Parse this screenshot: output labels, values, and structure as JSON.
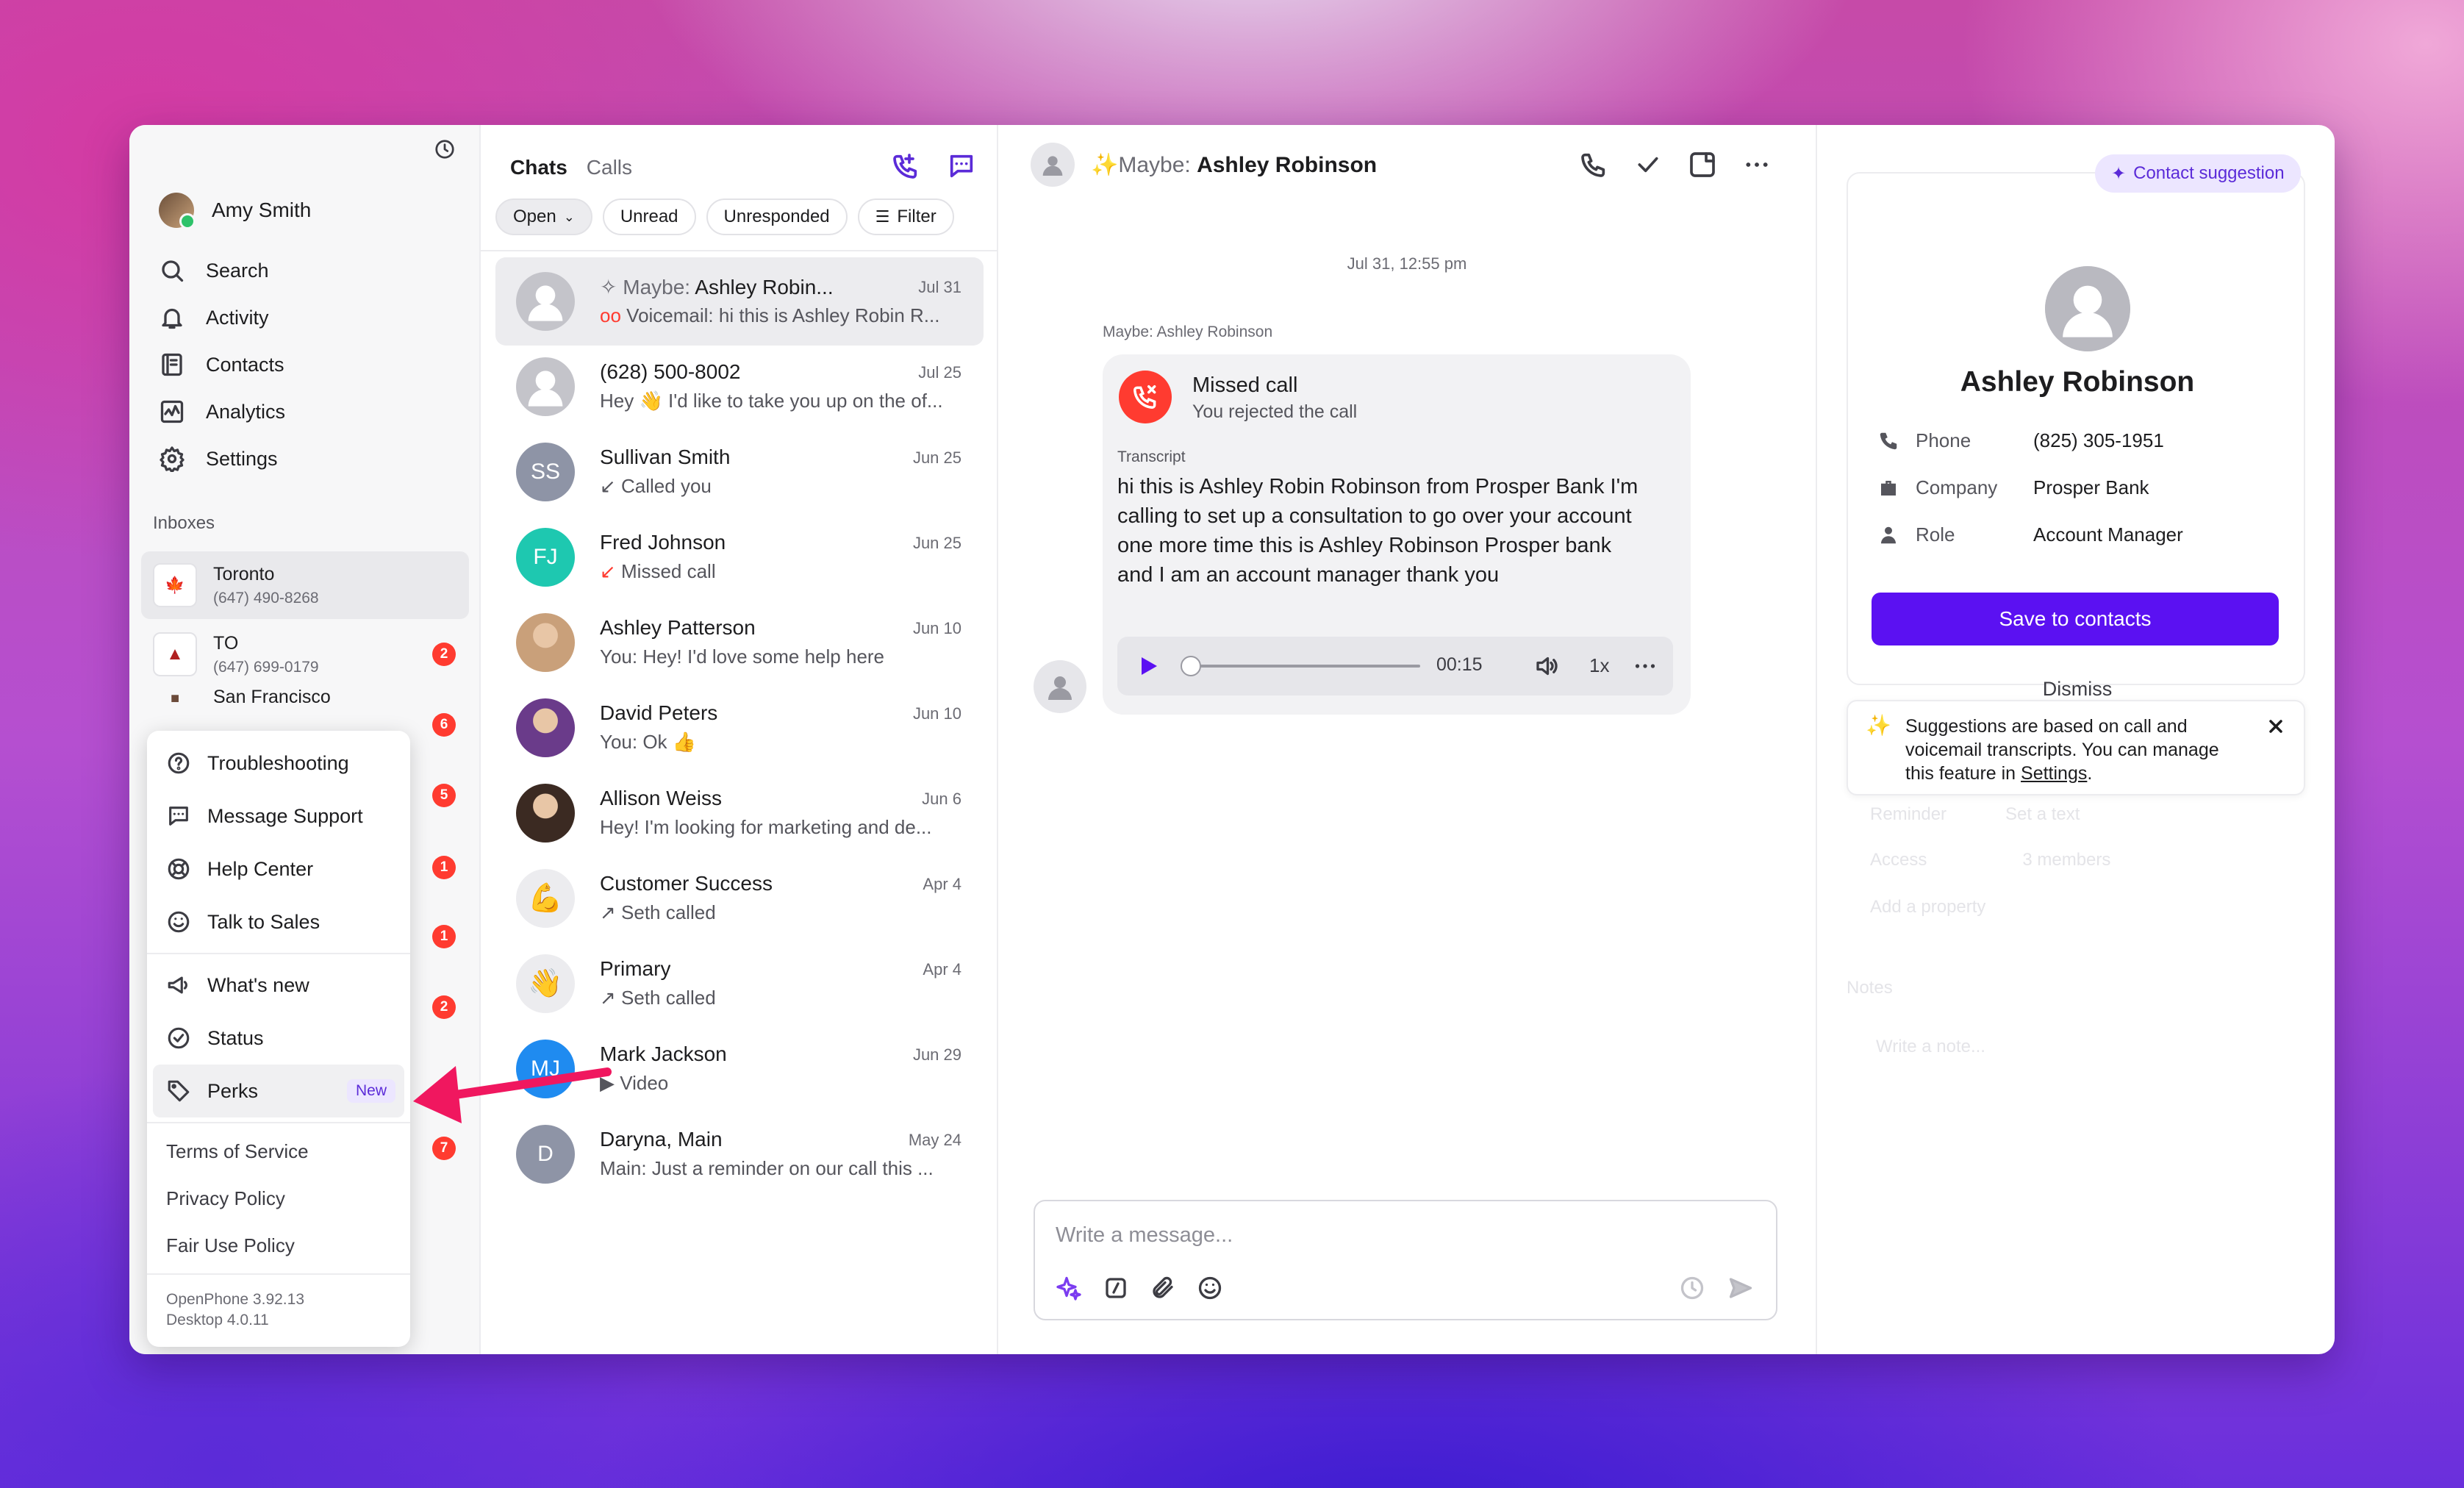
{
  "sidebar": {
    "user_name": "Amy Smith",
    "nav": [
      {
        "label": "Search",
        "icon": "search-icon"
      },
      {
        "label": "Activity",
        "icon": "bell-icon"
      },
      {
        "label": "Contacts",
        "icon": "contacts-icon"
      },
      {
        "label": "Analytics",
        "icon": "analytics-icon"
      },
      {
        "label": "Settings",
        "icon": "gear-icon"
      }
    ],
    "inboxes_label": "Inboxes",
    "inboxes": [
      {
        "name": "Toronto",
        "number": "(647) 490-8268"
      },
      {
        "name": "TO",
        "number": "(647) 699-0179",
        "badge": "2"
      },
      {
        "name": "San Francisco",
        "badge": "6"
      }
    ],
    "hidden_badges": [
      "5",
      "1",
      "1",
      "2",
      "7"
    ]
  },
  "help_menu": {
    "items": [
      {
        "label": "Troubleshooting",
        "icon": "question-icon"
      },
      {
        "label": "Message Support",
        "icon": "chat-icon"
      },
      {
        "label": "Help Center",
        "icon": "lifebuoy-icon"
      },
      {
        "label": "Talk to Sales",
        "icon": "smile-icon"
      }
    ],
    "items2": [
      {
        "label": "What's new",
        "icon": "megaphone-icon"
      },
      {
        "label": "Status",
        "icon": "check-circle-icon"
      },
      {
        "label": "Perks",
        "icon": "tag-icon",
        "badge": "New"
      }
    ],
    "links": [
      "Terms of Service",
      "Privacy Policy",
      "Fair Use Policy"
    ],
    "version_app": "OpenPhone 3.92.13",
    "version_desktop": "Desktop 4.0.11"
  },
  "list": {
    "tab_chats": "Chats",
    "tab_calls": "Calls",
    "filters": {
      "open": "Open",
      "unread": "Unread",
      "unresponded": "Unresponded",
      "filter": "Filter"
    },
    "items": [
      {
        "prefix": "Maybe: ",
        "name": "Ashley Robin...",
        "date": "Jul 31",
        "sub": "Voicemail: hi this is Ashley Robin R...",
        "avatar": "person",
        "active": true
      },
      {
        "name": "(628) 500-8002",
        "date": "Jul 25",
        "sub": "Hey 👋 I'd like to take you up on the of...",
        "avatar": "person"
      },
      {
        "name": "Sullivan Smith",
        "date": "Jun 25",
        "sub": "Called you",
        "avatar": "SS",
        "color": "#8e94a6",
        "mark": "↙"
      },
      {
        "name": "Fred Johnson",
        "date": "Jun 25",
        "sub": "Missed call",
        "avatar": "FJ",
        "color": "#1ec8b0",
        "mark": "↙"
      },
      {
        "name": "Ashley Patterson",
        "date": "Jun 10",
        "sub": "You: Hey! I'd love some help here",
        "avatar": "photo",
        "color": "#c9a07a"
      },
      {
        "name": "David Peters",
        "date": "Jun 10",
        "sub": "You: Ok 👍",
        "avatar": "photo",
        "color": "#6a3b8a"
      },
      {
        "name": "Allison Weiss",
        "date": "Jun 6",
        "sub": "Hey! I'm looking for marketing and de...",
        "avatar": "photo",
        "color": "#3b2a22"
      },
      {
        "name": "Customer Success",
        "date": "Apr 4",
        "sub": "Seth called",
        "avatar": "💪",
        "color": "#ececef",
        "mark": "↗"
      },
      {
        "name": "Primary",
        "date": "Apr 4",
        "sub": "Seth called",
        "avatar": "👋",
        "color": "#ececef",
        "mark": "↗"
      },
      {
        "name": "Mark Jackson",
        "date": "Jun 29",
        "sub": "Video",
        "avatar": "MJ",
        "color": "#1f8bf0",
        "mark": "▶"
      },
      {
        "name": "Daryna, Main",
        "date": "May 24",
        "sub": "Main: Just a reminder on our call this ...",
        "avatar": "D",
        "color": "#8e94a6"
      }
    ]
  },
  "conversation": {
    "header_prefix": "Maybe: ",
    "header_name": "Ashley Robinson",
    "date": "Jul 31, 12:55 pm",
    "from": "Maybe: Ashley Robinson",
    "call_title": "Missed call",
    "call_sub": "You rejected the call",
    "transcript_label": "Transcript",
    "transcript": "hi this is Ashley Robin Robinson from Prosper Bank I'm calling to set up a consultation to go over your account one more time this is Ashley Robinson Prosper bank and I am an account manager thank you",
    "audio_time": "00:15",
    "audio_speed": "1x",
    "audio_progress": 0,
    "composer_placeholder": "Write a message..."
  },
  "detail": {
    "pill": "Contact suggestion",
    "name": "Ashley Robinson",
    "props": [
      {
        "key": "Phone",
        "value": "(825) 305-1951",
        "icon": "phone-icon"
      },
      {
        "key": "Company",
        "value": "Prosper Bank",
        "icon": "briefcase-icon"
      },
      {
        "key": "Role",
        "value": "Account Manager",
        "icon": "person-icon"
      }
    ],
    "save": "Save to contacts",
    "dismiss": "Dismiss",
    "info_prefix": "Suggestions are based on call and voicemail transcripts. You can manage this feature in ",
    "info_link": "Settings",
    "info_suffix": ".",
    "ghost": [
      "Reminder",
      "Set a text",
      "Access",
      "3 members",
      "Add a property",
      "Notes",
      "Write a note..."
    ]
  },
  "colors": {
    "accent": "#5b11f2",
    "badge": "#ff3b30",
    "arrow": "#f0175f"
  }
}
